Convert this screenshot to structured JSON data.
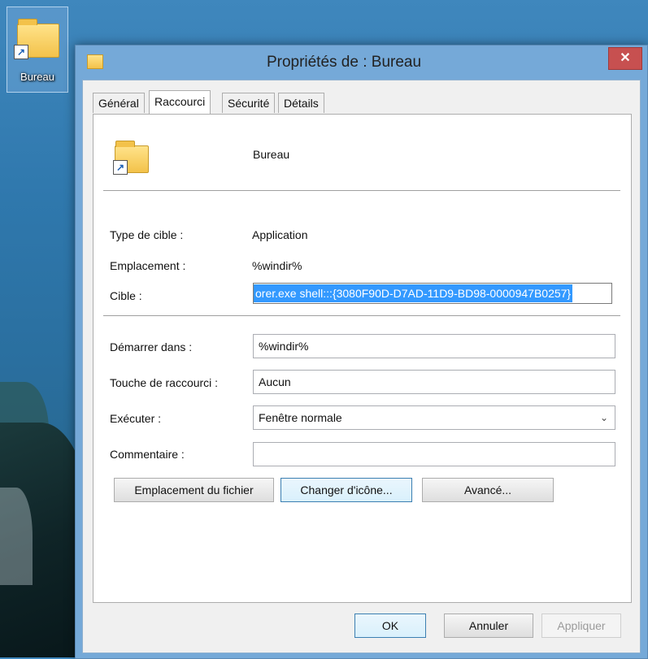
{
  "desktop": {
    "icon_label": "Bureau"
  },
  "dialog": {
    "title": "Propriétés de : Bureau",
    "tabs": [
      {
        "label": "Général"
      },
      {
        "label": "Raccourci"
      },
      {
        "label": "Sécurité"
      },
      {
        "label": "Détails"
      }
    ],
    "active_tab": "Raccourci",
    "shortcut_name": "Bureau",
    "fields": {
      "target_type_label": "Type de cible :",
      "target_type_value": "Application",
      "location_label": "Emplacement :",
      "location_value": "%windir%",
      "target_label": "Cible :",
      "target_value": "orer.exe shell:::{3080F90D-D7AD-11D9-BD98-0000947B0257}",
      "start_in_label": "Démarrer dans :",
      "start_in_value": "%windir%",
      "shortcut_key_label": "Touche de raccourci :",
      "shortcut_key_value": "Aucun",
      "run_label": "Exécuter :",
      "run_value": "Fenêtre normale",
      "comment_label": "Commentaire :",
      "comment_value": ""
    },
    "buttons": {
      "open_file_location": "Emplacement du fichier",
      "change_icon": "Changer d'icône...",
      "advanced": "Avancé...",
      "ok": "OK",
      "cancel": "Annuler",
      "apply": "Appliquer"
    },
    "close_glyph": "✕"
  },
  "colors": {
    "title_bar": "#75a9d8",
    "close_button": "#c75050",
    "selection": "#3399ff"
  }
}
